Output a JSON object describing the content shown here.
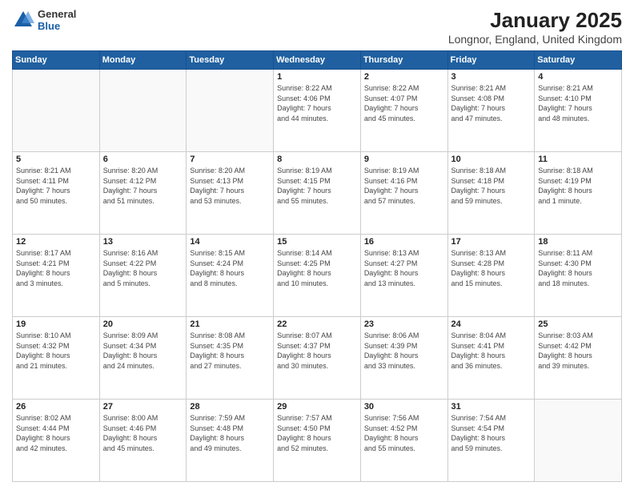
{
  "header": {
    "logo_general": "General",
    "logo_blue": "Blue",
    "title": "January 2025",
    "subtitle": "Longnor, England, United Kingdom"
  },
  "columns": [
    "Sunday",
    "Monday",
    "Tuesday",
    "Wednesday",
    "Thursday",
    "Friday",
    "Saturday"
  ],
  "weeks": [
    [
      {
        "day": "",
        "info": ""
      },
      {
        "day": "",
        "info": ""
      },
      {
        "day": "",
        "info": ""
      },
      {
        "day": "1",
        "info": "Sunrise: 8:22 AM\nSunset: 4:06 PM\nDaylight: 7 hours\nand 44 minutes."
      },
      {
        "day": "2",
        "info": "Sunrise: 8:22 AM\nSunset: 4:07 PM\nDaylight: 7 hours\nand 45 minutes."
      },
      {
        "day": "3",
        "info": "Sunrise: 8:21 AM\nSunset: 4:08 PM\nDaylight: 7 hours\nand 47 minutes."
      },
      {
        "day": "4",
        "info": "Sunrise: 8:21 AM\nSunset: 4:10 PM\nDaylight: 7 hours\nand 48 minutes."
      }
    ],
    [
      {
        "day": "5",
        "info": "Sunrise: 8:21 AM\nSunset: 4:11 PM\nDaylight: 7 hours\nand 50 minutes."
      },
      {
        "day": "6",
        "info": "Sunrise: 8:20 AM\nSunset: 4:12 PM\nDaylight: 7 hours\nand 51 minutes."
      },
      {
        "day": "7",
        "info": "Sunrise: 8:20 AM\nSunset: 4:13 PM\nDaylight: 7 hours\nand 53 minutes."
      },
      {
        "day": "8",
        "info": "Sunrise: 8:19 AM\nSunset: 4:15 PM\nDaylight: 7 hours\nand 55 minutes."
      },
      {
        "day": "9",
        "info": "Sunrise: 8:19 AM\nSunset: 4:16 PM\nDaylight: 7 hours\nand 57 minutes."
      },
      {
        "day": "10",
        "info": "Sunrise: 8:18 AM\nSunset: 4:18 PM\nDaylight: 7 hours\nand 59 minutes."
      },
      {
        "day": "11",
        "info": "Sunrise: 8:18 AM\nSunset: 4:19 PM\nDaylight: 8 hours\nand 1 minute."
      }
    ],
    [
      {
        "day": "12",
        "info": "Sunrise: 8:17 AM\nSunset: 4:21 PM\nDaylight: 8 hours\nand 3 minutes."
      },
      {
        "day": "13",
        "info": "Sunrise: 8:16 AM\nSunset: 4:22 PM\nDaylight: 8 hours\nand 5 minutes."
      },
      {
        "day": "14",
        "info": "Sunrise: 8:15 AM\nSunset: 4:24 PM\nDaylight: 8 hours\nand 8 minutes."
      },
      {
        "day": "15",
        "info": "Sunrise: 8:14 AM\nSunset: 4:25 PM\nDaylight: 8 hours\nand 10 minutes."
      },
      {
        "day": "16",
        "info": "Sunrise: 8:13 AM\nSunset: 4:27 PM\nDaylight: 8 hours\nand 13 minutes."
      },
      {
        "day": "17",
        "info": "Sunrise: 8:13 AM\nSunset: 4:28 PM\nDaylight: 8 hours\nand 15 minutes."
      },
      {
        "day": "18",
        "info": "Sunrise: 8:11 AM\nSunset: 4:30 PM\nDaylight: 8 hours\nand 18 minutes."
      }
    ],
    [
      {
        "day": "19",
        "info": "Sunrise: 8:10 AM\nSunset: 4:32 PM\nDaylight: 8 hours\nand 21 minutes."
      },
      {
        "day": "20",
        "info": "Sunrise: 8:09 AM\nSunset: 4:34 PM\nDaylight: 8 hours\nand 24 minutes."
      },
      {
        "day": "21",
        "info": "Sunrise: 8:08 AM\nSunset: 4:35 PM\nDaylight: 8 hours\nand 27 minutes."
      },
      {
        "day": "22",
        "info": "Sunrise: 8:07 AM\nSunset: 4:37 PM\nDaylight: 8 hours\nand 30 minutes."
      },
      {
        "day": "23",
        "info": "Sunrise: 8:06 AM\nSunset: 4:39 PM\nDaylight: 8 hours\nand 33 minutes."
      },
      {
        "day": "24",
        "info": "Sunrise: 8:04 AM\nSunset: 4:41 PM\nDaylight: 8 hours\nand 36 minutes."
      },
      {
        "day": "25",
        "info": "Sunrise: 8:03 AM\nSunset: 4:42 PM\nDaylight: 8 hours\nand 39 minutes."
      }
    ],
    [
      {
        "day": "26",
        "info": "Sunrise: 8:02 AM\nSunset: 4:44 PM\nDaylight: 8 hours\nand 42 minutes."
      },
      {
        "day": "27",
        "info": "Sunrise: 8:00 AM\nSunset: 4:46 PM\nDaylight: 8 hours\nand 45 minutes."
      },
      {
        "day": "28",
        "info": "Sunrise: 7:59 AM\nSunset: 4:48 PM\nDaylight: 8 hours\nand 49 minutes."
      },
      {
        "day": "29",
        "info": "Sunrise: 7:57 AM\nSunset: 4:50 PM\nDaylight: 8 hours\nand 52 minutes."
      },
      {
        "day": "30",
        "info": "Sunrise: 7:56 AM\nSunset: 4:52 PM\nDaylight: 8 hours\nand 55 minutes."
      },
      {
        "day": "31",
        "info": "Sunrise: 7:54 AM\nSunset: 4:54 PM\nDaylight: 8 hours\nand 59 minutes."
      },
      {
        "day": "",
        "info": ""
      }
    ]
  ]
}
